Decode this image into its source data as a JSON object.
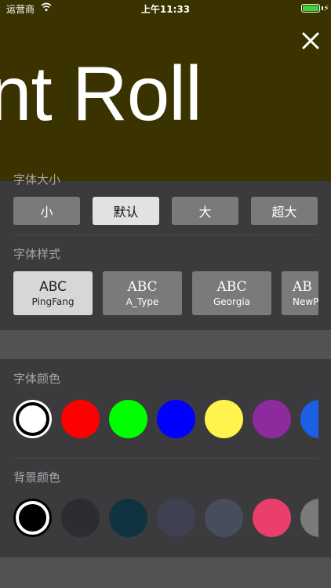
{
  "status_bar": {
    "carrier": "运营商",
    "time": "上午11:33"
  },
  "preview": {
    "text": "nt Roll",
    "background": "#3a3300",
    "text_color": "#ffffff"
  },
  "font_size": {
    "label": "字体大小",
    "options": [
      {
        "label": "小",
        "selected": false
      },
      {
        "label": "默认",
        "selected": true
      },
      {
        "label": "大",
        "selected": false
      },
      {
        "label": "超大",
        "selected": false
      }
    ]
  },
  "font_style": {
    "label": "字体样式",
    "options": [
      {
        "sample": "ABC",
        "name": "PingFang",
        "selected": true
      },
      {
        "sample": "ABC",
        "name": "A_Type",
        "selected": false
      },
      {
        "sample": "ABC",
        "name": "Georgia",
        "selected": false
      },
      {
        "sample": "AB",
        "name": "NewPing",
        "selected": false
      }
    ]
  },
  "font_color": {
    "label": "字体颜色",
    "swatches": [
      "#ffffff",
      "#ff0000",
      "#00ff00",
      "#0000ff",
      "#fff34e",
      "#8e2a9e",
      "#1d5fe6"
    ],
    "selected_index": 0
  },
  "background_color": {
    "label": "背景颜色",
    "swatches": [
      "#000000",
      "#2b2d33",
      "#103341",
      "#3f4152",
      "#474d5c",
      "#ea3f6b",
      "#7a7a78"
    ],
    "selected_index": 0
  }
}
